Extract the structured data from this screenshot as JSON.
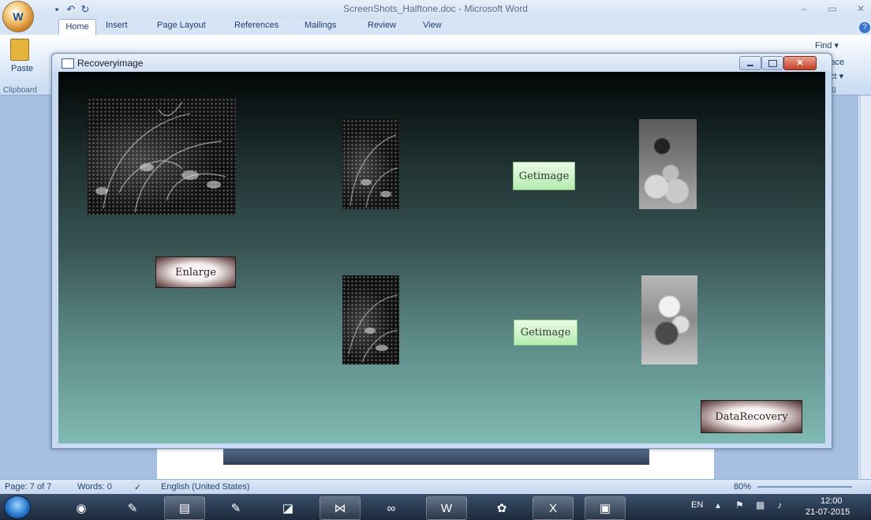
{
  "word": {
    "title": "ScreenShots_Halftone.doc - Microsoft Word",
    "office_button": "W",
    "tabs": [
      "Home",
      "Insert",
      "Page Layout",
      "References",
      "Mailings",
      "Review",
      "View"
    ],
    "paste_label": "Paste",
    "clipboard_label": "Clipboard",
    "find_label": "Find ▾",
    "replace_label": "lace",
    "select_label": "ct ▾",
    "editing_label": "ig",
    "status": {
      "page": "Page: 7 of 7",
      "words": "Words: 0",
      "language": "English (United States)",
      "zoom": "80%"
    }
  },
  "dialog": {
    "title": "Recoveryimage",
    "close_glyph": "✕",
    "buttons": {
      "enlarge": "Enlarge",
      "getimage_1": "Getimage",
      "getimage_2": "Getimage",
      "data_recovery": "DataRecovery"
    }
  },
  "taskbar": {
    "lang": "EN",
    "time": "12:00",
    "date": "21-07-2015"
  },
  "colors": {
    "canvas_top": "#020505",
    "canvas_bottom": "#80b9b3",
    "button_green": "#b6ecb0",
    "close_red": "#c5412a"
  },
  "icons": [
    "office-orb-icon",
    "save-icon",
    "undo-icon",
    "redo-icon",
    "paste-icon",
    "help-icon",
    "start-orb-icon",
    "chrome-icon",
    "tools-icon",
    "folder-icon",
    "visual-studio-icon",
    "word-icon",
    "excel-icon"
  ]
}
